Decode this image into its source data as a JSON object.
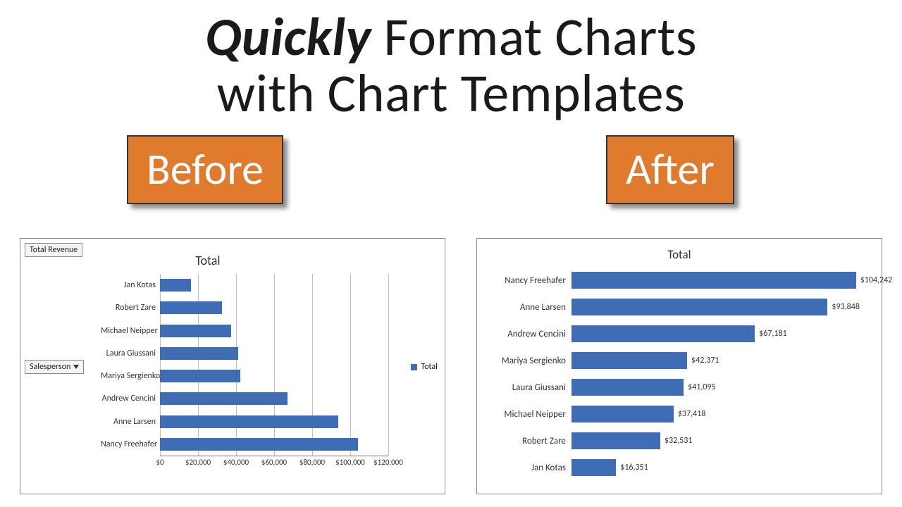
{
  "headline": {
    "emph": "Quickly",
    "rest1": " Format Charts",
    "line2": "with Chart Templates"
  },
  "badges": {
    "before": "Before",
    "after": "After"
  },
  "before_chart": {
    "title": "Total",
    "field_revenue": "Total Revenue",
    "field_salesperson": "Salesperson",
    "legend_label": "Total"
  },
  "chart_data": [
    {
      "name": "before",
      "type": "bar",
      "orientation": "horizontal",
      "title": "Total",
      "xlabel": "",
      "ylabel": "",
      "xlim": [
        0,
        120000
      ],
      "xticks": [
        0,
        20000,
        40000,
        60000,
        80000,
        100000,
        120000
      ],
      "xtick_labels": [
        "$0",
        "$20,000",
        "$40,000",
        "$60,000",
        "$80,000",
        "$100,000",
        "$120,000"
      ],
      "legend": [
        "Total"
      ],
      "categories_top_to_bottom": [
        "Jan Kotas",
        "Robert Zare",
        "Michael Neipper",
        "Laura Giussani",
        "Mariya Sergienko",
        "Andrew Cencini",
        "Anne Larsen",
        "Nancy Freehafer"
      ],
      "values_top_to_bottom": [
        16351,
        32531,
        37418,
        41095,
        42371,
        67181,
        93848,
        104242
      ]
    },
    {
      "name": "after",
      "type": "bar",
      "orientation": "horizontal",
      "title": "Total",
      "xlabel": "",
      "ylabel": "",
      "xlim": [
        0,
        110000
      ],
      "data_labels": true,
      "categories_top_to_bottom": [
        "Nancy Freehafer",
        "Anne Larsen",
        "Andrew Cencini",
        "Mariya Sergienko",
        "Laura Giussani",
        "Michael Neipper",
        "Robert Zare",
        "Jan Kotas"
      ],
      "values_top_to_bottom": [
        104242,
        93848,
        67181,
        42371,
        41095,
        37418,
        32531,
        16351
      ],
      "value_labels_top_to_bottom": [
        "$104,242",
        "$93,848",
        "$67,181",
        "$42,371",
        "$41,095",
        "$37,418",
        "$32,531",
        "$16,351"
      ]
    }
  ],
  "colors": {
    "bar": "#3e6db5",
    "badge_bg": "#e07a2c"
  }
}
